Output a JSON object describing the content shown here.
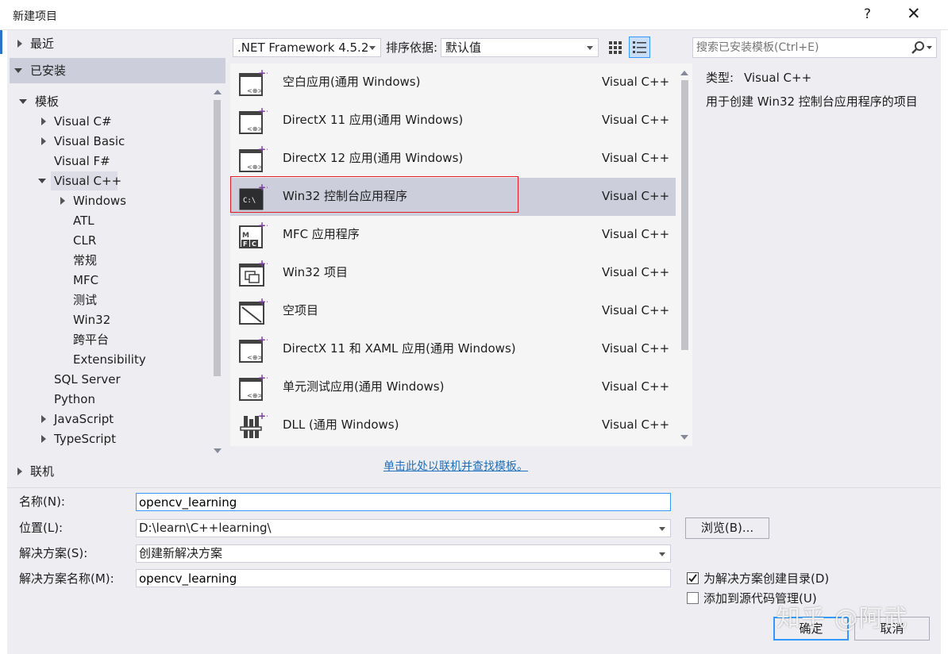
{
  "window": {
    "title": "新建项目",
    "help_label": "?",
    "close_label": "✕"
  },
  "tree": {
    "recent": "最近",
    "installed": "已安装",
    "templates": "模板",
    "items": [
      {
        "label": "Visual C#"
      },
      {
        "label": "Visual Basic"
      },
      {
        "label": "Visual F#"
      },
      {
        "label": "Visual C++"
      },
      {
        "label": "Windows"
      },
      {
        "label": "ATL"
      },
      {
        "label": "CLR"
      },
      {
        "label": "常规"
      },
      {
        "label": "MFC"
      },
      {
        "label": "测试"
      },
      {
        "label": "Win32"
      },
      {
        "label": "跨平台"
      },
      {
        "label": "Extensibility"
      },
      {
        "label": "SQL Server"
      },
      {
        "label": "Python"
      },
      {
        "label": "JavaScript"
      },
      {
        "label": "TypeScript"
      }
    ],
    "online": "联机"
  },
  "toolbar": {
    "framework": ".NET Framework 4.5.2",
    "sort_label": "排序依据:",
    "sort_value": "默认值",
    "search_placeholder": "搜索已安装模板(Ctrl+E)"
  },
  "templates": [
    {
      "name": "空白应用(通用 Windows)",
      "lang": "Visual C++",
      "icon": "universal-app-icon"
    },
    {
      "name": "DirectX 11 应用(通用 Windows)",
      "lang": "Visual C++",
      "icon": "universal-app-icon"
    },
    {
      "name": "DirectX 12 应用(通用 Windows)",
      "lang": "Visual C++",
      "icon": "universal-app-icon"
    },
    {
      "name": "Win32 控制台应用程序",
      "lang": "Visual C++",
      "icon": "console-app-icon",
      "selected": true
    },
    {
      "name": "MFC 应用程序",
      "lang": "Visual C++",
      "icon": "mfc-icon"
    },
    {
      "name": "Win32 项目",
      "lang": "Visual C++",
      "icon": "win32-project-icon"
    },
    {
      "name": "空项目",
      "lang": "Visual C++",
      "icon": "empty-project-icon"
    },
    {
      "name": "DirectX 11 和 XAML 应用(通用 Windows)",
      "lang": "Visual C++",
      "icon": "universal-app-icon"
    },
    {
      "name": "单元测试应用(通用 Windows)",
      "lang": "Visual C++",
      "icon": "universal-app-icon"
    },
    {
      "name": "DLL (通用 Windows)",
      "lang": "Visual C++",
      "icon": "dll-icon"
    }
  ],
  "online_link": "单击此处以联机并查找模板。",
  "details": {
    "type_label": "类型:",
    "type_value": "Visual C++",
    "description": "用于创建 Win32 控制台应用程序的项目"
  },
  "form": {
    "name_label": "名称(N):",
    "name_value": "opencv_learning",
    "location_label": "位置(L):",
    "location_value": "D:\\learn\\C++learning\\",
    "browse_label": "浏览(B)...",
    "solution_label": "解决方案(S):",
    "solution_value": "创建新解决方案",
    "solution_name_label": "解决方案名称(M):",
    "solution_name_value": "opencv_learning",
    "create_dir_label": "为解决方案创建目录(D)",
    "create_dir_checked": true,
    "source_control_label": "添加到源代码管理(U)",
    "source_control_checked": false
  },
  "buttons": {
    "ok": "确定",
    "cancel": "取消"
  },
  "watermark": "知乎 @阿武",
  "colors": {
    "selection": "#cccedb",
    "highlight_border": "#e41b23",
    "link": "#1e6ebe",
    "accent": "#7a3e9d"
  }
}
